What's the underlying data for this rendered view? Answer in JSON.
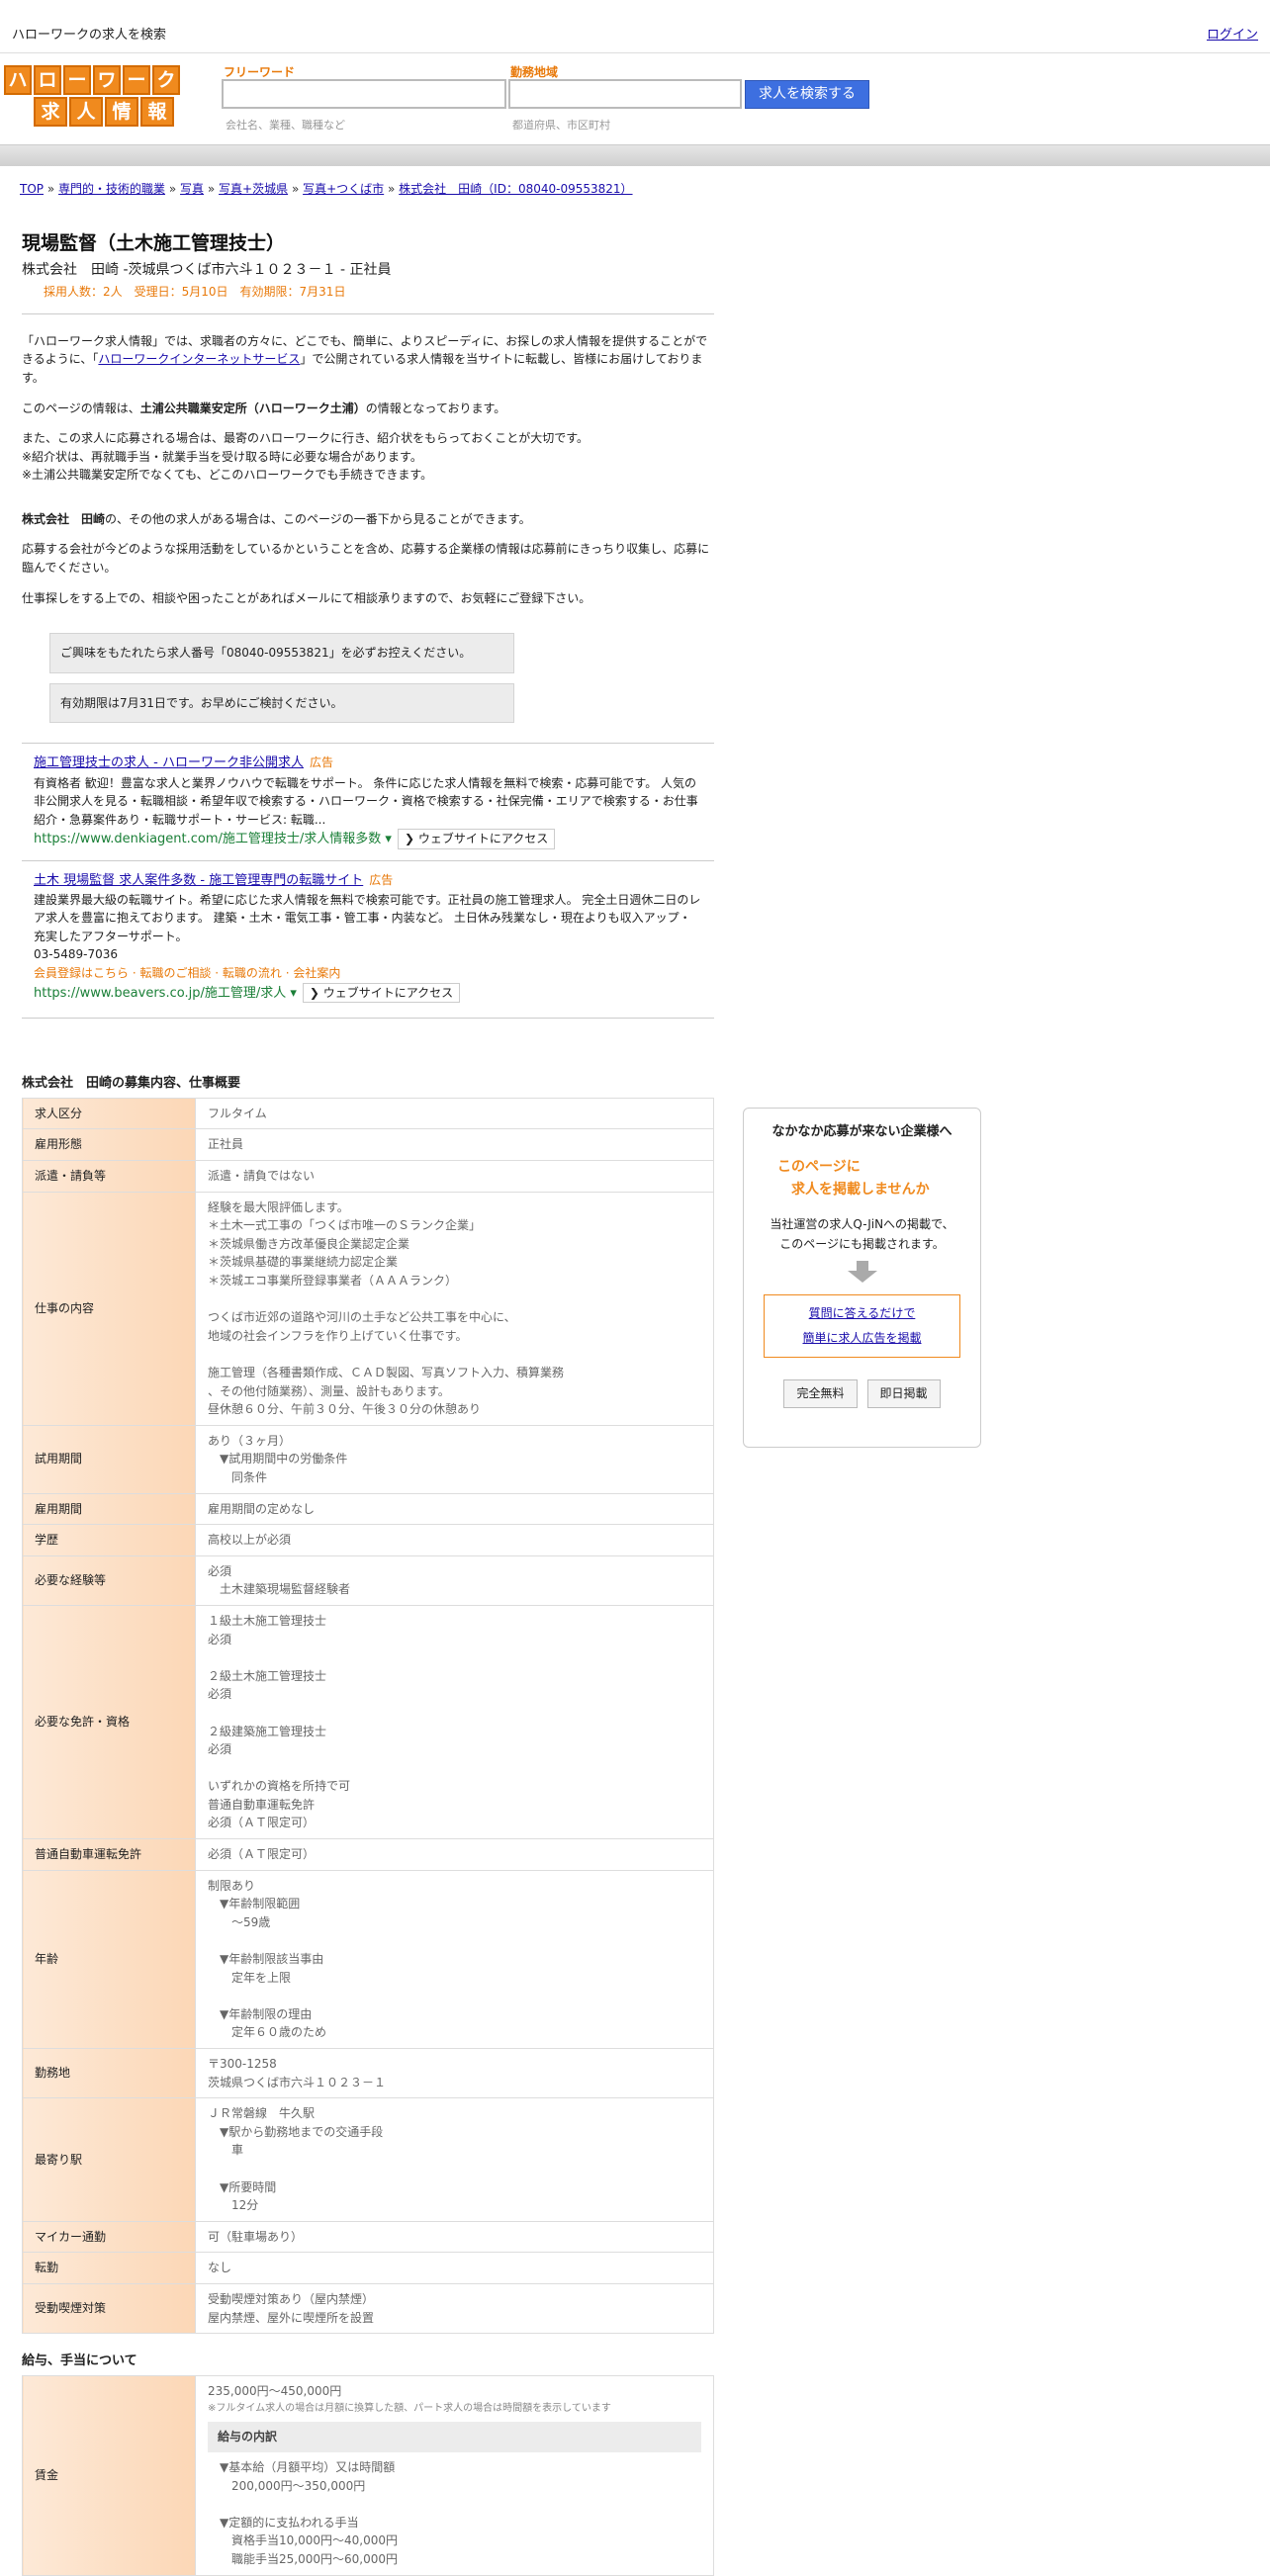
{
  "topbar": {
    "site_label": "ハローワークの求人を検索",
    "login": "ログイン"
  },
  "logo": {
    "row1": [
      "ハ",
      "ロ",
      "ー",
      "ワ",
      "ー",
      "ク"
    ],
    "row2": [
      "求",
      "人",
      "情",
      "報"
    ]
  },
  "search": {
    "keyword_label": "フリーワード",
    "keyword_hint": "会社名、業種、職種など",
    "area_label": "勤務地域",
    "area_hint": "都道府県、市区町村",
    "button": "求人を検索する"
  },
  "breadcrumb": {
    "items": [
      "TOP",
      "専門的・技術的職業",
      "写真",
      "写真+茨城県",
      "写真+つくば市",
      "株式会社　田崎（ID：08040-09553821）"
    ],
    "sep": "»"
  },
  "job": {
    "title": "現場監督（土木施工管理技士）",
    "company_line": "株式会社　田崎 -茨城県つくば市六斗１０２３－１ - 正社員",
    "meta": "採用人数：2人　受理日：5月10日　有効期限：7月31日"
  },
  "intro": {
    "p1_a": "「ハローワーク求人情報」では、求職者の方々に、どこでも、簡単に、よりスピーディに、お探しの求人情報を提供することができるように、「",
    "p1_link": "ハローワークインターネットサービス",
    "p1_b": "」で公開されている求人情報を当サイトに転載し、皆様にお届けしております。",
    "p2_a": "このページの情報は、",
    "p2_bold": "土浦公共職業安定所（ハローワーク土浦）",
    "p2_b": "の情報となっております。",
    "p3_l1": "また、この求人に応募される場合は、最寄のハローワークに行き、紹介状をもらっておくことが大切です。",
    "p3_l2": "※紹介状は、再就職手当・就業手当を受け取る時に必要な場合があります。",
    "p3_l3": "※土浦公共職業安定所でなくても、どこのハローワークでも手続きできます。",
    "p4_bold": "株式会社　田崎",
    "p4_b": "の、その他の求人がある場合は、このページの一番下から見ることができます。",
    "p5": "応募する会社が今どのような採用活動をしているかということを含め、応募する企業様の情報は応募前にきっちり収集し、応募に臨んでください。",
    "p6": "仕事探しをする上での、相談や困ったことがあればメールにて相談承りますので、お気軽にご登録下さい。"
  },
  "notices": [
    "ご興味をもたれたら求人番号「08040-09553821」を必ずお控えください。",
    "有効期限は7月31日です。お早めにご検討ください。"
  ],
  "ads": [
    {
      "title": "施工管理技士の求人 - ハローワーク非公開求人",
      "badge": "広告",
      "body": "有資格者 歓迎！豊富な求人と業界ノウハウで転職をサポート。 条件に応じた求人情報を無料で検索・応募可能です。 人気の非公開求人を見る・転職相談・希望年収で検索する・ハローワーク・資格で検索する・社保完備・エリアで検索する・お仕事紹介・急募案件あり・転職サポート・サービス: 転職...",
      "url": "https://www.denkiagent.com/施工管理技士/求人情報多数",
      "visit": "❯ ウェブサイトにアクセス"
    },
    {
      "title": "土木 現場監督 求人案件多数 - 施工管理専門の転職サイト",
      "badge": "広告",
      "body": "建設業界最大級の転職サイト。希望に応じた求人情報を無料で検索可能です。正社員の施工管理求人。 完全土日週休二日のレア求人を豊富に抱えております。 建築・土木・電気工事・管工事・内装など。 土日休み残業なし・現在よりも収入アップ・充実したアフターサポート。",
      "phone": "03-5489-7036",
      "links": "会員登録はこちら · 転職のご相談 · 転職の流れ · 会社案内",
      "url": "https://www.beavers.co.jp/施工管理/求人",
      "visit": "❯ ウェブサイトにアクセス"
    }
  ],
  "overview": {
    "title": "株式会社　田崎の募集内容、仕事概要",
    "rows": [
      {
        "label": "求人区分",
        "value": "フルタイム"
      },
      {
        "label": "雇用形態",
        "value": "正社員"
      },
      {
        "label": "派遣・請負等",
        "value": "派遣・請負ではない"
      },
      {
        "label": "仕事の内容",
        "value": "経験を最大限評価します。\n＊土木一式工事の「つくば市唯一のＳランク企業」\n＊茨城県働き方改革優良企業認定企業\n＊茨城県基礎的事業継続力認定企業\n＊茨城エコ事業所登録事業者（ＡＡＡランク）\n\nつくば市近郊の道路や河川の土手など公共工事を中心に、\n地域の社会インフラを作り上げていく仕事です。\n\n施工管理（各種書類作成、ＣＡＤ製図、写真ソフト入力、積算業務\n、その他付随業務）、測量、設計もあります。\n昼休憩６０分、午前３０分、午後３０分の休憩あり"
      },
      {
        "label": "試用期間",
        "value": "あり（３ヶ月）\n　▼試用期間中の労働条件\n　　同条件"
      },
      {
        "label": "雇用期間",
        "value": "雇用期間の定めなし"
      },
      {
        "label": "学歴",
        "value": "高校以上が必須"
      },
      {
        "label": "必要な経験等",
        "value": "必須\n　土木建築現場監督経験者"
      },
      {
        "label": "必要な免許・資格",
        "value": "１級土木施工管理技士\n必須\n\n２級土木施工管理技士\n必須\n\n２級建築施工管理技士\n必須\n\nいずれかの資格を所持で可\n普通自動車運転免許\n必須（ＡＴ限定可）"
      },
      {
        "label": "普通自動車運転免許",
        "value": "必須（ＡＴ限定可）"
      },
      {
        "label": "年齢",
        "value": "制限あり\n　▼年齢制限範囲\n　　〜59歳\n\n　▼年齢制限該当事由\n　　定年を上限\n\n　▼年齢制限の理由\n　　定年６０歳のため"
      },
      {
        "label": "勤務地",
        "value": "〒300-1258\n茨城県つくば市六斗１０２３－１"
      },
      {
        "label": "最寄り駅",
        "value": "ＪＲ常磐線　牛久駅\n　▼駅から勤務地までの交通手段\n　　車\n\n　▼所要時間\n　　12分"
      },
      {
        "label": "マイカー通勤",
        "value": "可（駐車場あり）"
      },
      {
        "label": "転勤",
        "value": "なし"
      },
      {
        "label": "受動喫煙対策",
        "value": "受動喫煙対策あり（屋内禁煙）\n屋内禁煙、屋外に喫煙所を設置"
      }
    ]
  },
  "salary": {
    "title": "給与、手当について",
    "label": "賃金",
    "range": "235,000円〜450,000円",
    "note": "※フルタイム求人の場合は月額に換算した額、パート求人の場合は時間額を表示しています",
    "box_title": "給与の内訳",
    "detail": "　▼基本給（月額平均）又は時間額\n　　200,000円〜350,000円\n\n　▼定額的に支払われる手当\n　　資格手当10,000円〜40,000円\n　　職能手当25,000円〜60,000円"
  },
  "promo": {
    "title": "なかなか応募が来ない企業様へ",
    "catch_l1": "このページに",
    "catch_l2": "求人を掲載しませんか",
    "text_l1": "当社運営の求人Q-JiNへの掲載で、",
    "text_l2": "このページにも掲載されます。",
    "link1": "質問に答えるだけで",
    "link2": "簡単に求人広告を掲載",
    "btn1": "完全無料",
    "btn2": "即日掲載"
  }
}
